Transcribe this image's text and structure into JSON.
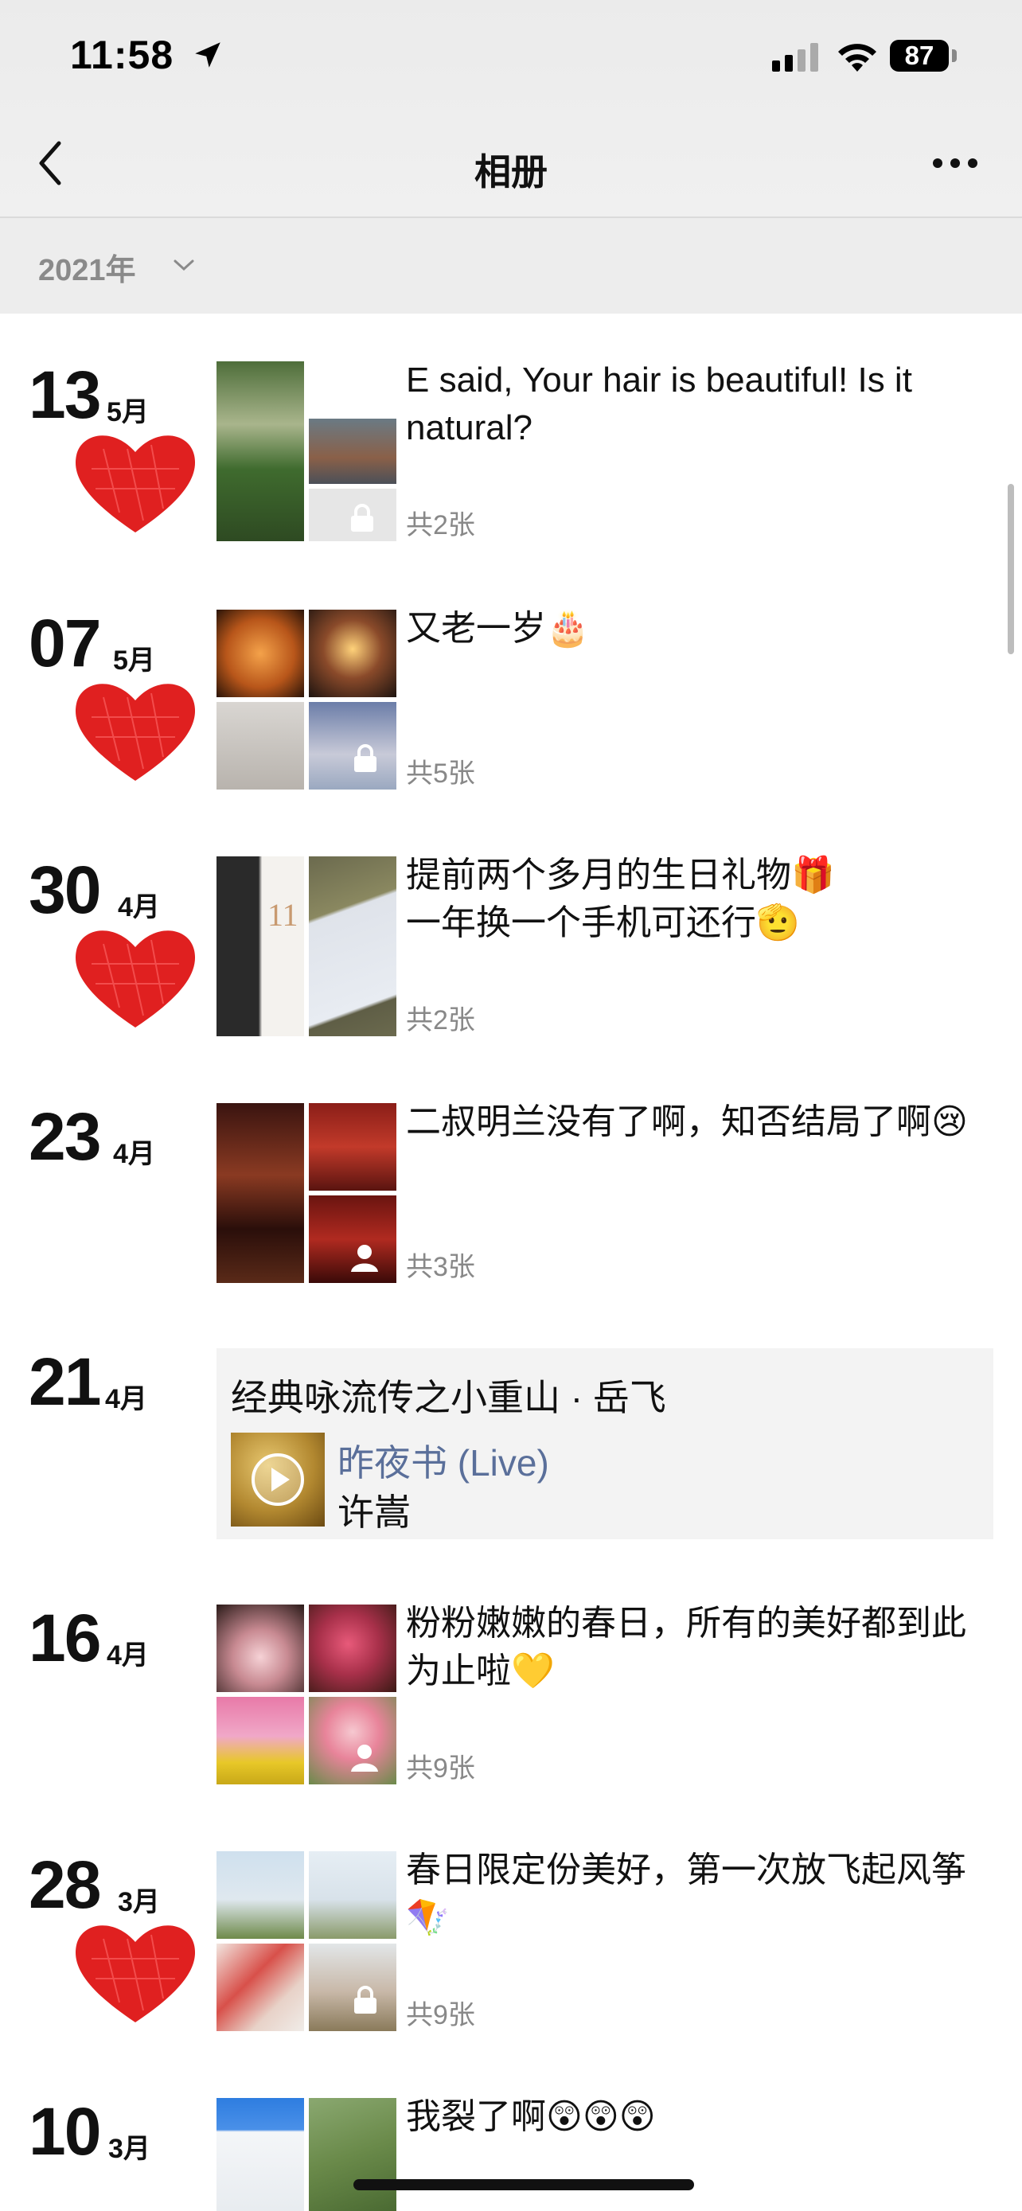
{
  "status_bar": {
    "time": "11:58",
    "battery": "87"
  },
  "nav": {
    "title": "相册"
  },
  "year_filter": {
    "label": "2021年"
  },
  "entries": [
    {
      "day": "13",
      "month": "5月",
      "caption": "E said, Your hair is beautiful! Is it natural?",
      "count": "共2张"
    },
    {
      "day": "07",
      "month": "5月",
      "caption": "又老一岁🎂",
      "count": "共5张"
    },
    {
      "day": "30",
      "month": "4月",
      "caption": "提前两个多月的生日礼物🎁\n一年换一个手机可还行🫡",
      "count": "共2张",
      "phone_digits": "11"
    },
    {
      "day": "23",
      "month": "4月",
      "caption": "二叔明兰没有了啊，知否结局了啊😢",
      "count": "共3张"
    },
    {
      "day": "21",
      "month": "4月",
      "music": {
        "title": "经典咏流传之小重山 · 岳飞",
        "song": "昨夜书 (Live)",
        "artist": "许嵩"
      }
    },
    {
      "day": "16",
      "month": "4月",
      "caption": "粉粉嫩嫩的春日，所有的美好都到此为止啦💛",
      "count": "共9张"
    },
    {
      "day": "28",
      "month": "3月",
      "caption": "春日限定份美好，第一次放飞起风筝🪁",
      "count": "共9张"
    },
    {
      "day": "10",
      "month": "3月",
      "caption": "我裂了啊😲😲😲"
    }
  ],
  "colors": {
    "heart": "#e02020",
    "link": "#5a6f9a",
    "count": "#888888"
  }
}
